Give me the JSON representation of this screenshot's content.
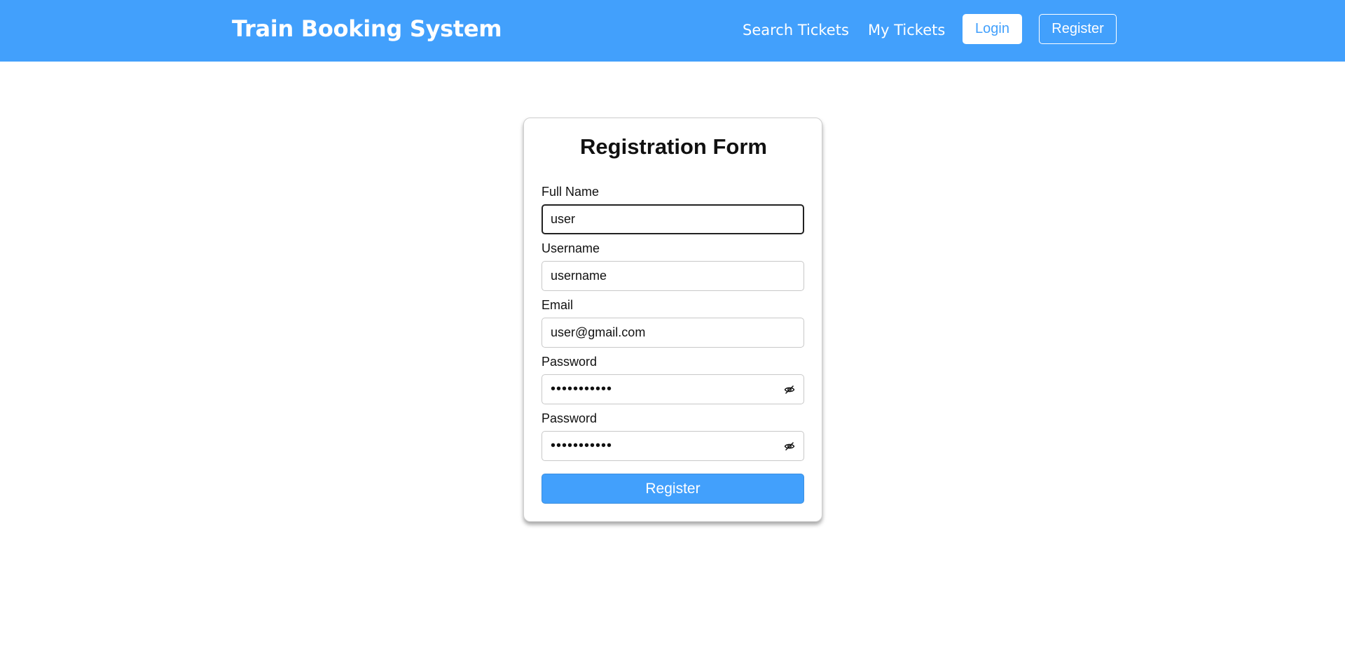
{
  "header": {
    "brand": "Train Booking System",
    "nav": {
      "search_tickets": "Search Tickets",
      "my_tickets": "My Tickets",
      "login": "Login",
      "register": "Register"
    }
  },
  "form": {
    "title": "Registration Form",
    "full_name": {
      "label": "Full Name",
      "value": "user"
    },
    "username": {
      "label": "Username",
      "value": "username"
    },
    "email": {
      "label": "Email",
      "value": "user@gmail.com"
    },
    "password": {
      "label": "Password",
      "value": "•••••••••••",
      "icon": "eye-slash-icon"
    },
    "confirm_password": {
      "label": "Password",
      "value": "•••••••••••",
      "icon": "eye-slash-icon"
    },
    "submit": "Register"
  },
  "colors": {
    "accent": "#42a0fc",
    "background": "#ffffff",
    "text": "#111111"
  }
}
